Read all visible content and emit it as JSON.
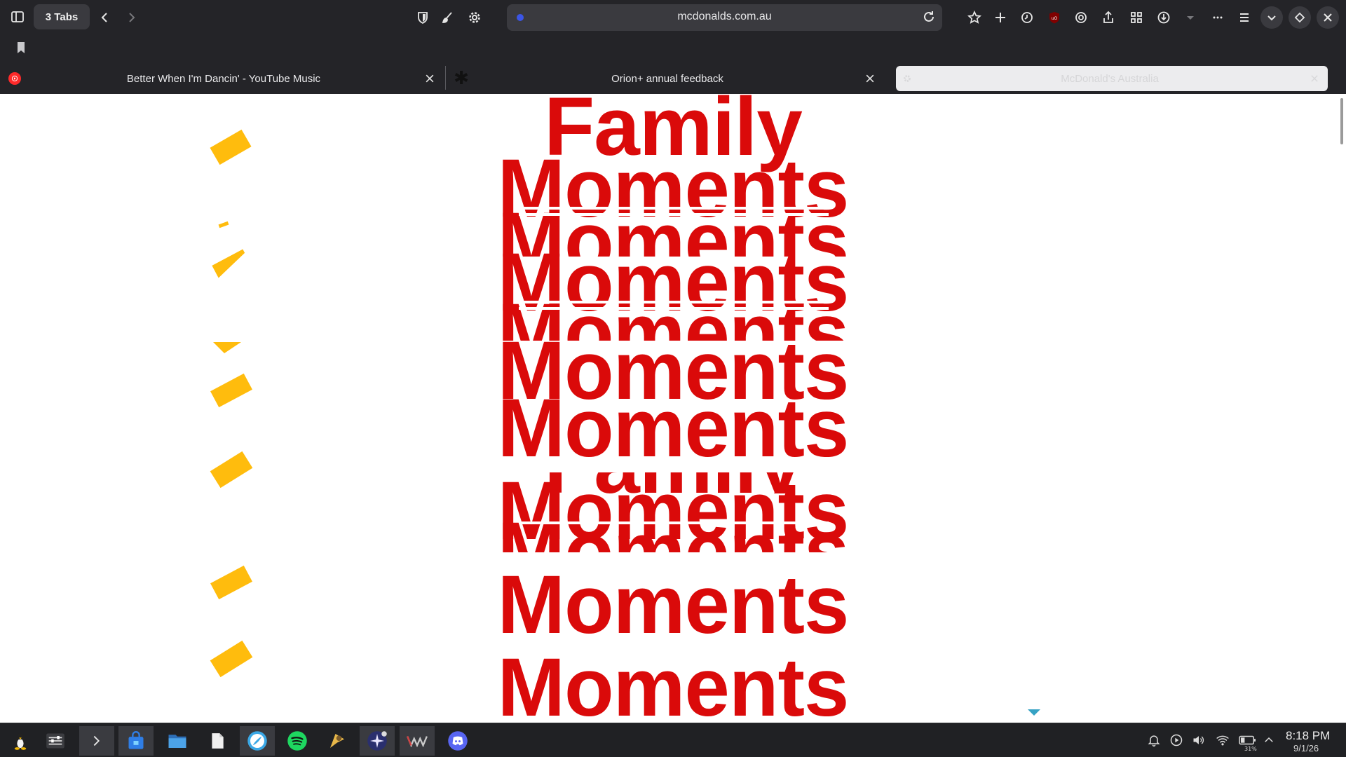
{
  "browser": {
    "tabs_count_label": "3 Tabs",
    "url": "mcdonalds.com.au",
    "tabs": [
      {
        "title": "Better When I'm Dancin' - YouTube Music",
        "active": false
      },
      {
        "title": "Orion+ annual feedback",
        "active": false
      },
      {
        "title": "McDonald's Australia",
        "active": true
      }
    ]
  },
  "page": {
    "repeated_word_1": "Family",
    "repeated_word_2": "Moments",
    "brand_red": "#da0a0a",
    "ribbon_yellow": "#ffbc0d"
  },
  "taskbar": {
    "apps": [
      "linux-icon",
      "mixer-icon",
      "terminal-icon",
      "store-icon",
      "files-icon",
      "document-icon",
      "browser-icon",
      "spotify-icon",
      "game-icon",
      "orion-icon",
      "wm-icon",
      "discord-icon"
    ],
    "time": "8:18 PM",
    "date": "9/1/26",
    "battery": "31%"
  }
}
